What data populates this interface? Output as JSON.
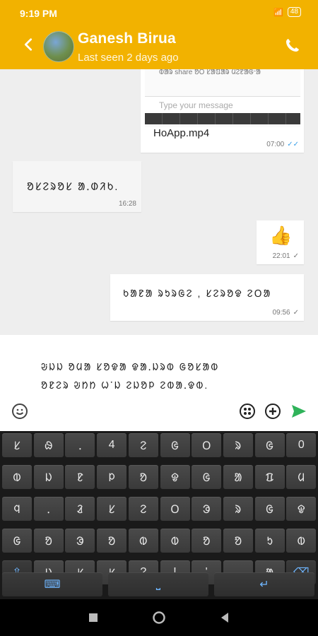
{
  "status": {
    "time": "9:19 PM",
    "battery": "48"
  },
  "header": {
    "name": "Ganesh Birua",
    "last_seen": "Last seen 2 days ago"
  },
  "colors": {
    "accent": "#f2b200",
    "send": "#2fb35a",
    "read_tick": "#3aa0e8"
  },
  "messages": [
    {
      "id": "m1",
      "direction": "outgoing",
      "preview_top": "ᱵᱟᱨ share ᱚᱛ ᱥᱟᱯᱟᱨ ᱢᱮᱱᱟᱜᱼᱟ",
      "preview_hint": "Type your message",
      "file": "HoApp.mp4",
      "time": "07:00",
      "ticks": "read"
    },
    {
      "id": "m2",
      "direction": "incoming",
      "text": "ᱚᱥᱮᱨᱚᱥ ᱟᱹᱰᱤᱠ.",
      "time": "16:28"
    },
    {
      "id": "m3",
      "direction": "outgoing",
      "emoji": "👍",
      "time": "22:01",
      "ticks": "sent"
    },
    {
      "id": "m4",
      "direction": "outgoing",
      "text": "ᱠᱟᱱᱟ ᱨᱩᱨᱜᱮ , ᱥᱮᱨᱚᱫ ᱮᱛᱟ",
      "time": "09:56",
      "ticks": "sent"
    }
  ],
  "composer": {
    "line1": "ᱶᱡᱡ ᱚᱢᱟ ᱥᱚᱫᱟ ᱫᱟᱹᱡᱨᱵ ᱜᱚᱥᱟᱵ",
    "line2": "ᱚᱱᱮᱨ ᱶᱴᱴ ᱦᱸᱡ ᱮᱡᱚᱞ ᱮᱵᱟᱹᱫᱵ."
  },
  "keyboard": {
    "row1": [
      "ᱥ",
      "ᱷ",
      "ᱹ",
      "4",
      "ᱮ",
      "ᱜ",
      "ᱛ",
      "ᱨ",
      "ᱜ",
      "0"
    ],
    "row2": [
      "ᱵ",
      "ᱡ",
      "ᱱ",
      "ᱞ",
      "ᱚ",
      "ᱫ",
      "ᱜ",
      "ᱟ",
      "ᱯ",
      "ᱢ"
    ],
    "row3": [
      "ᱧ",
      "ᱹ",
      "ᱲ",
      "ᱥ",
      "ᱮ",
      "ᱛ",
      "ᱳ",
      "ᱨ",
      "ᱜ",
      "ᱫ"
    ],
    "row4": [
      "ᱜ",
      "ᱚ",
      "ᱳ",
      "ᱚ",
      "ᱵ",
      "ᱵ",
      "ᱚ",
      "ᱚ",
      "ᱩ",
      "ᱵ"
    ],
    "row5": [
      "⇧",
      "ᱡ",
      "ᱥ",
      "ᱥ",
      "?",
      "!",
      "'",
      ".",
      "ᱟ",
      "⌫"
    ]
  },
  "icons": {
    "back": "back-arrow-icon",
    "call": "phone-icon",
    "emoji": "emoji-icon",
    "send": "send-icon",
    "add": "add-circle-icon",
    "keypad": "keyboard-icon"
  }
}
